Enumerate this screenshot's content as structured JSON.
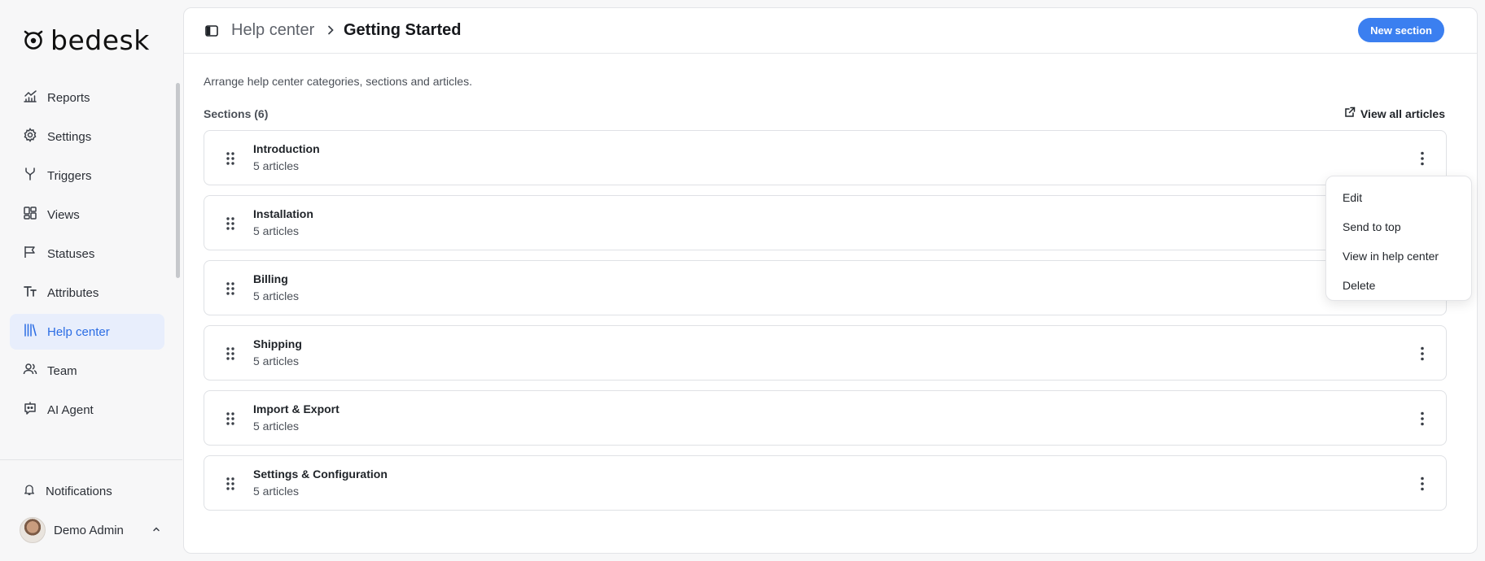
{
  "brand": {
    "name": "bedesk",
    "logo_icon": "bedesk-logo-icon"
  },
  "sidebar": {
    "items": [
      {
        "label": "Reports",
        "icon": "chart-line-icon",
        "active": false
      },
      {
        "label": "Settings",
        "icon": "gear-icon",
        "active": false
      },
      {
        "label": "Triggers",
        "icon": "branch-icon",
        "active": false
      },
      {
        "label": "Views",
        "icon": "layout-grid-icon",
        "active": false
      },
      {
        "label": "Statuses",
        "icon": "flag-icon",
        "active": false
      },
      {
        "label": "Attributes",
        "icon": "text-size-icon",
        "active": false
      },
      {
        "label": "Help center",
        "icon": "library-icon",
        "active": true
      },
      {
        "label": "Team",
        "icon": "users-icon",
        "active": false
      },
      {
        "label": "AI Agent",
        "icon": "bot-message-icon",
        "active": false
      }
    ],
    "notifications_label": "Notifications",
    "user_name": "Demo Admin"
  },
  "header": {
    "breadcrumb_parent": "Help center",
    "breadcrumb_current": "Getting Started",
    "new_section_label": "New section"
  },
  "main": {
    "description": "Arrange help center categories, sections and articles.",
    "sections_title": "Sections (6)",
    "view_all_label": "View all articles",
    "sections": [
      {
        "title": "Introduction",
        "subtitle": "5 articles"
      },
      {
        "title": "Installation",
        "subtitle": "5 articles"
      },
      {
        "title": "Billing",
        "subtitle": "5 articles"
      },
      {
        "title": "Shipping",
        "subtitle": "5 articles"
      },
      {
        "title": "Import & Export",
        "subtitle": "5 articles"
      },
      {
        "title": "Settings & Configuration",
        "subtitle": "5 articles"
      }
    ]
  },
  "context_menu": {
    "items": [
      "Edit",
      "Send to top",
      "View in help center",
      "Delete"
    ]
  },
  "colors": {
    "accent": "#3b7ff0",
    "active_nav_bg": "#e8eefc",
    "active_nav_text": "#2b6de4"
  }
}
